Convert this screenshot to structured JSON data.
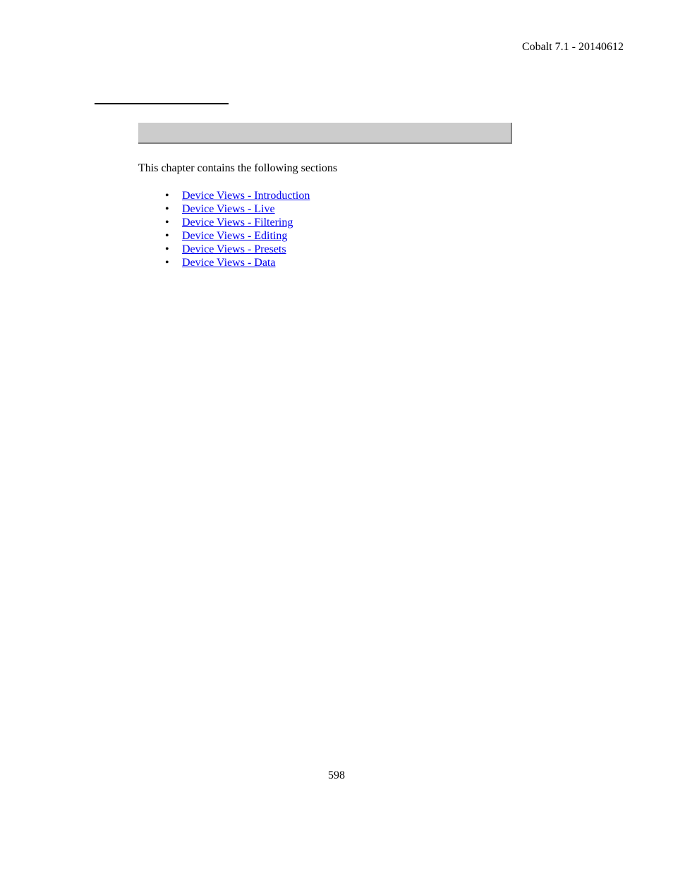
{
  "header": {
    "version_text": "Cobalt 7.1 - 20140612"
  },
  "content": {
    "intro_text": "This chapter contains the following sections",
    "links": [
      "Device Views - Introduction",
      "Device Views - Live",
      "Device Views - Filtering",
      "Device Views - Editing",
      "Device Views - Presets",
      "Device Views - Data"
    ]
  },
  "footer": {
    "page_number": "598"
  }
}
